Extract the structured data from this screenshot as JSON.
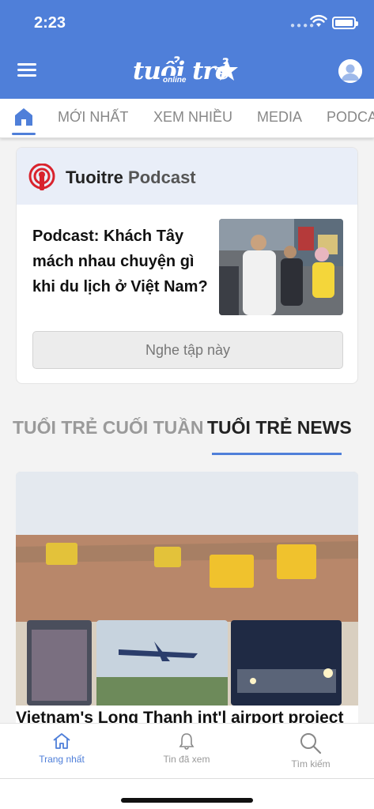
{
  "status_bar": {
    "time": "2:23"
  },
  "header": {
    "logo_text": "tuổi trẻ",
    "logo_sub": "online"
  },
  "tabs": [
    {
      "label": "MỚI NHẤT"
    },
    {
      "label": "XEM NHIỀU"
    },
    {
      "label": "MEDIA"
    },
    {
      "label": "PODCA"
    }
  ],
  "podcast": {
    "brand": "Tuoitre",
    "brand_sub": "Podcast",
    "title": "Podcast: Khách Tây mách nhau chuyện gì khi du lịch ở Việt Nam?",
    "button_label": "Nghe tập này"
  },
  "section_tabs": {
    "weekend": "TUỔI TRẺ CUỐI TUẦN",
    "news": "TUỔI TRẺ NEWS"
  },
  "article": {
    "title": "Vietnam's Long Thanh int'l airport project"
  },
  "bottom_nav": [
    {
      "label": "Trang nhất",
      "icon": "home-icon"
    },
    {
      "label": "Tin đã xem",
      "icon": "bell-icon"
    },
    {
      "label": "Tìm kiếm",
      "icon": "search-icon"
    }
  ],
  "colors": {
    "brand_blue": "#4f7fd9",
    "accent_red": "#d9232d"
  }
}
